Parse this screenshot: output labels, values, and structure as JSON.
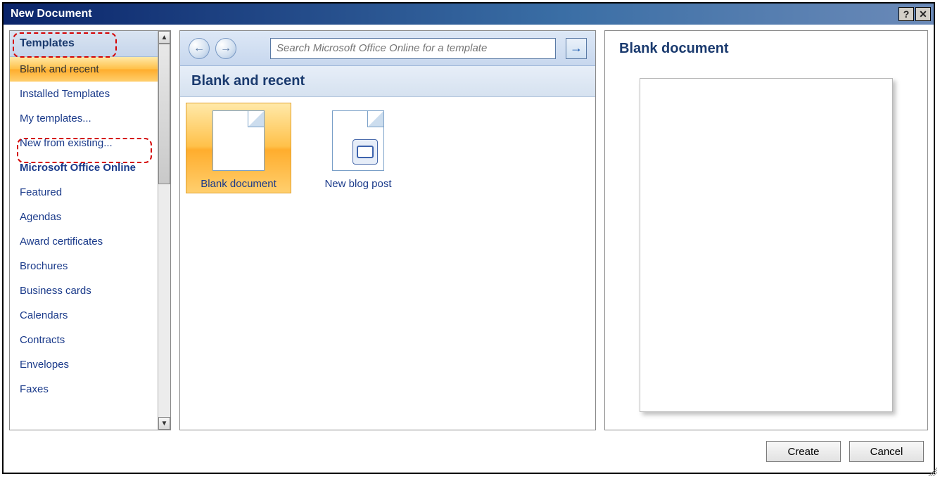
{
  "title": "New Document",
  "sidebar": {
    "header": "Templates",
    "items": [
      {
        "label": "Blank and recent",
        "selected": true,
        "strong": false
      },
      {
        "label": "Installed Templates",
        "selected": false,
        "strong": false
      },
      {
        "label": "My templates...",
        "selected": false,
        "strong": false
      },
      {
        "label": "New from existing...",
        "selected": false,
        "strong": false
      },
      {
        "label": "Microsoft Office Online",
        "selected": false,
        "strong": true
      },
      {
        "label": "Featured",
        "selected": false,
        "strong": false
      },
      {
        "label": "Agendas",
        "selected": false,
        "strong": false
      },
      {
        "label": "Award certificates",
        "selected": false,
        "strong": false
      },
      {
        "label": "Brochures",
        "selected": false,
        "strong": false
      },
      {
        "label": "Business cards",
        "selected": false,
        "strong": false
      },
      {
        "label": "Calendars",
        "selected": false,
        "strong": false
      },
      {
        "label": "Contracts",
        "selected": false,
        "strong": false
      },
      {
        "label": "Envelopes",
        "selected": false,
        "strong": false
      },
      {
        "label": "Faxes",
        "selected": false,
        "strong": false
      }
    ]
  },
  "search": {
    "placeholder": "Search Microsoft Office Online for a template"
  },
  "section_header": "Blank and recent",
  "templates": [
    {
      "label": "Blank document",
      "selected": true,
      "kind": "blank"
    },
    {
      "label": "New blog post",
      "selected": false,
      "kind": "blog"
    }
  ],
  "preview": {
    "title": "Blank document"
  },
  "buttons": {
    "create": "Create",
    "cancel": "Cancel"
  },
  "icons": {
    "back": "←",
    "forward": "→",
    "go": "→",
    "help": "?",
    "close": "✕",
    "scroll_up": "▲",
    "scroll_down": "▼"
  }
}
